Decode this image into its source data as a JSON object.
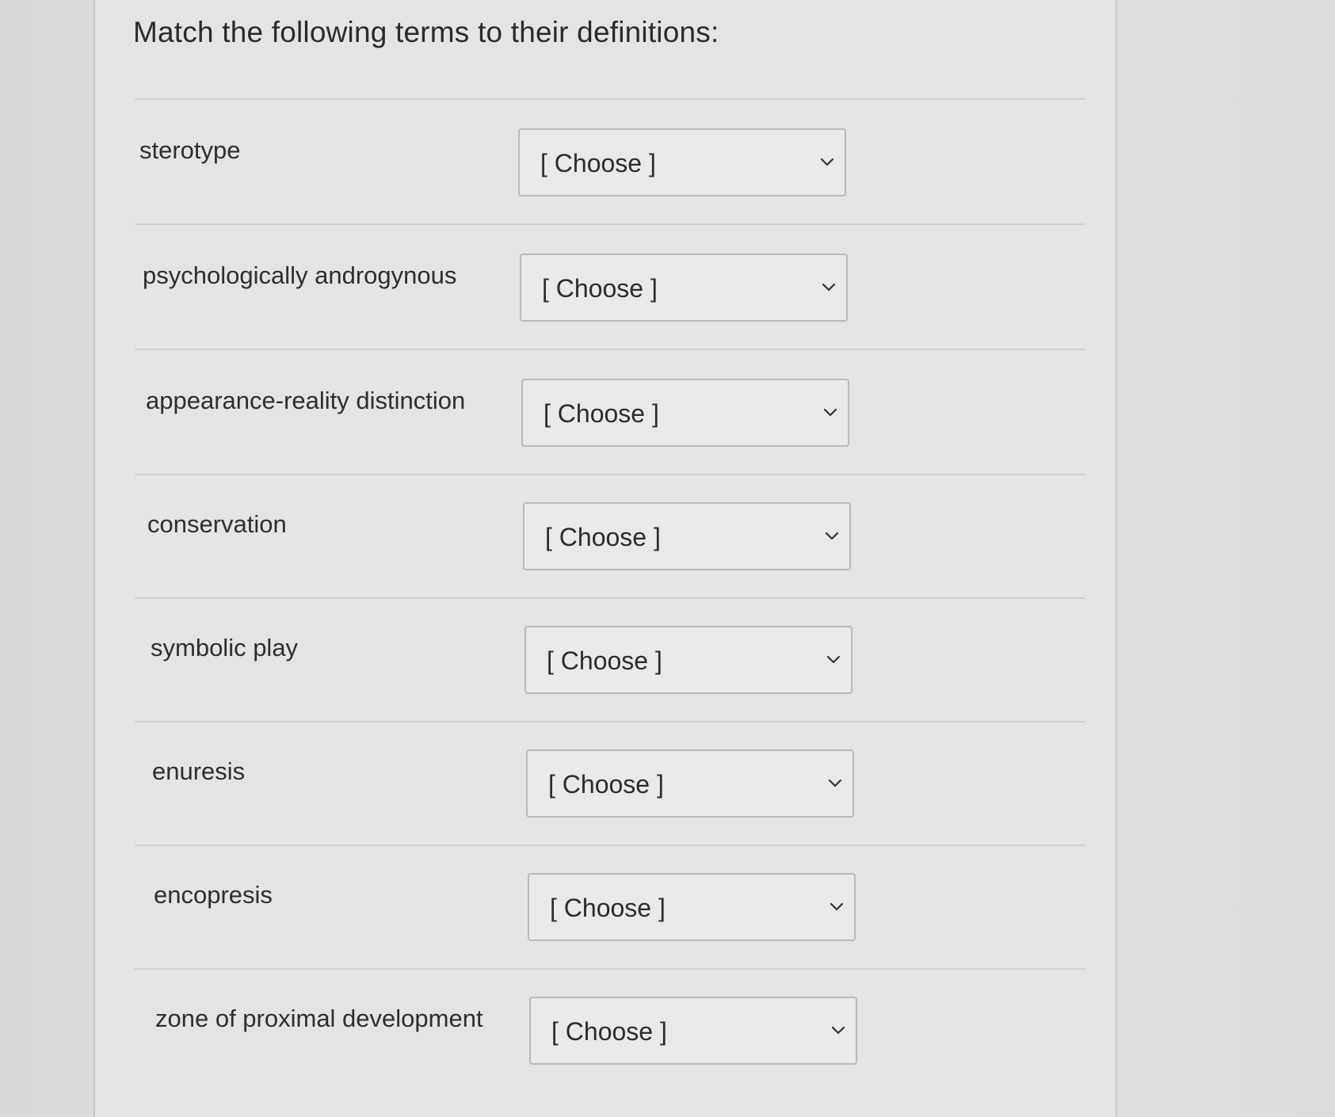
{
  "question": {
    "prompt": "Match the following terms to their definitions:"
  },
  "rows": [
    {
      "term": "sterotype",
      "selected": "[ Choose ]"
    },
    {
      "term": "psychologically androgynous",
      "selected": "[ Choose ]"
    },
    {
      "term": "appearance-reality distinction",
      "selected": "[ Choose ]"
    },
    {
      "term": "conservation",
      "selected": "[ Choose ]"
    },
    {
      "term": "symbolic play",
      "selected": "[ Choose ]"
    },
    {
      "term": "enuresis",
      "selected": "[ Choose ]"
    },
    {
      "term": "encopresis",
      "selected": "[ Choose ]"
    },
    {
      "term": "zone of proximal development",
      "selected": "[ Choose ]"
    }
  ],
  "icons": {
    "dropdown": "chevron-down-icon"
  },
  "colors": {
    "background": "#e4e4e4",
    "text": "#2e2e2e",
    "border": "#b9b9b9"
  }
}
